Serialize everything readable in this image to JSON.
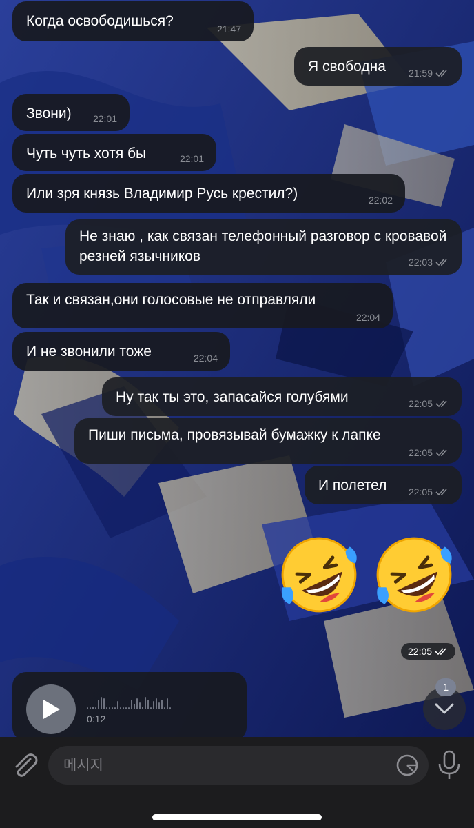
{
  "messages": [
    {
      "text": "Когда освободишься?",
      "time": "21:47",
      "dir": "in"
    },
    {
      "text": "Я свободна",
      "time": "21:59",
      "dir": "out"
    },
    {
      "text": "Звони)",
      "time": "22:01",
      "dir": "in"
    },
    {
      "text": "Чуть чуть хотя бы",
      "time": "22:01",
      "dir": "in"
    },
    {
      "text": "Или зря князь Владимир Русь крестил?)",
      "time": "22:02",
      "dir": "in"
    },
    {
      "text": "Не знаю , как связан телефонный разговор с кровавой резней язычников",
      "time": "22:03",
      "dir": "out"
    },
    {
      "text": "Так и связан,они голосовые не отправляли",
      "time": "22:04",
      "dir": "in"
    },
    {
      "text": "И не звонили тоже",
      "time": "22:04",
      "dir": "in"
    },
    {
      "text": "Ну так ты это, запасайся голубями",
      "time": "22:05",
      "dir": "out"
    },
    {
      "text": "Пиши письма, провязывай бумажку к лапке",
      "time": "22:05",
      "dir": "out"
    },
    {
      "text": "И полетел",
      "time": "22:05",
      "dir": "out"
    }
  ],
  "emoji_message": {
    "emoji": [
      "rolling-on-floor-laughing-icon",
      "rolling-on-floor-laughing-icon"
    ],
    "time": "22:05"
  },
  "voice_message": {
    "duration": "0:12"
  },
  "scroll_down": {
    "unread_count": "1"
  },
  "input": {
    "placeholder": "메시지"
  },
  "colors": {
    "bubble": "#1b1d23",
    "meta": "#8a8d94",
    "input_bar": "#1c1c1e"
  }
}
